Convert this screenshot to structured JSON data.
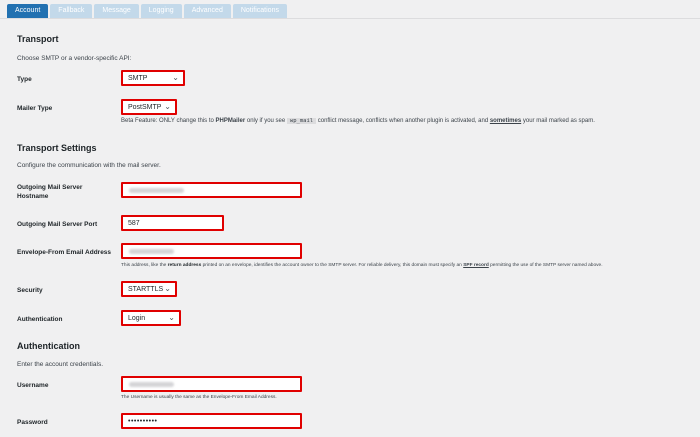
{
  "tabs": [
    "Account",
    "Fallback",
    "Message",
    "Logging",
    "Advanced",
    "Notifications"
  ],
  "transport": {
    "heading": "Transport",
    "desc": "Choose SMTP or a vendor-specific API:",
    "type_label": "Type",
    "type_value": "SMTP",
    "mailer_label": "Mailer Type",
    "mailer_value": "PostSMTP",
    "beta_prefix": "Beta Feature: ONLY change this to ",
    "beta_bold": "PHPMailer",
    "beta_mid": " only if you see ",
    "beta_code": "wp_mail",
    "beta_mid2": " conflict message, conflicts when another plugin is activated, and ",
    "beta_link": "sometimes",
    "beta_suffix": " your mail marked as spam."
  },
  "settings": {
    "heading": "Transport Settings",
    "desc": "Configure the communication with the mail server.",
    "hostname_label": "Outgoing Mail Server Hostname",
    "port_label": "Outgoing Mail Server Port",
    "port_value": "587",
    "envelope_label": "Envelope-From Email Address",
    "envelope_hint_1": "This address, like the ",
    "envelope_hint_bold": "return address",
    "envelope_hint_2": " printed on an envelope, identifies the account owner to the SMTP server. For reliable delivery, this domain must specify an ",
    "envelope_hint_link": "SPF record",
    "envelope_hint_3": " permitting the use of the SMTP server named above.",
    "security_label": "Security",
    "security_value": "STARTTLS",
    "auth_label": "Authentication",
    "auth_value": "Login"
  },
  "authentication": {
    "heading": "Authentication",
    "desc": "Enter the account credentials.",
    "username_label": "Username",
    "username_hint": "The Username is usually the same as the Envelope-From Email Address.",
    "password_label": "Password",
    "password_value": "••••••••••"
  },
  "icons": {
    "caret": "chevron-down-icon"
  },
  "colors": {
    "active_tab": "#2271b1",
    "inactive_tab": "#c3d9ea",
    "highlight": "#e00000"
  }
}
